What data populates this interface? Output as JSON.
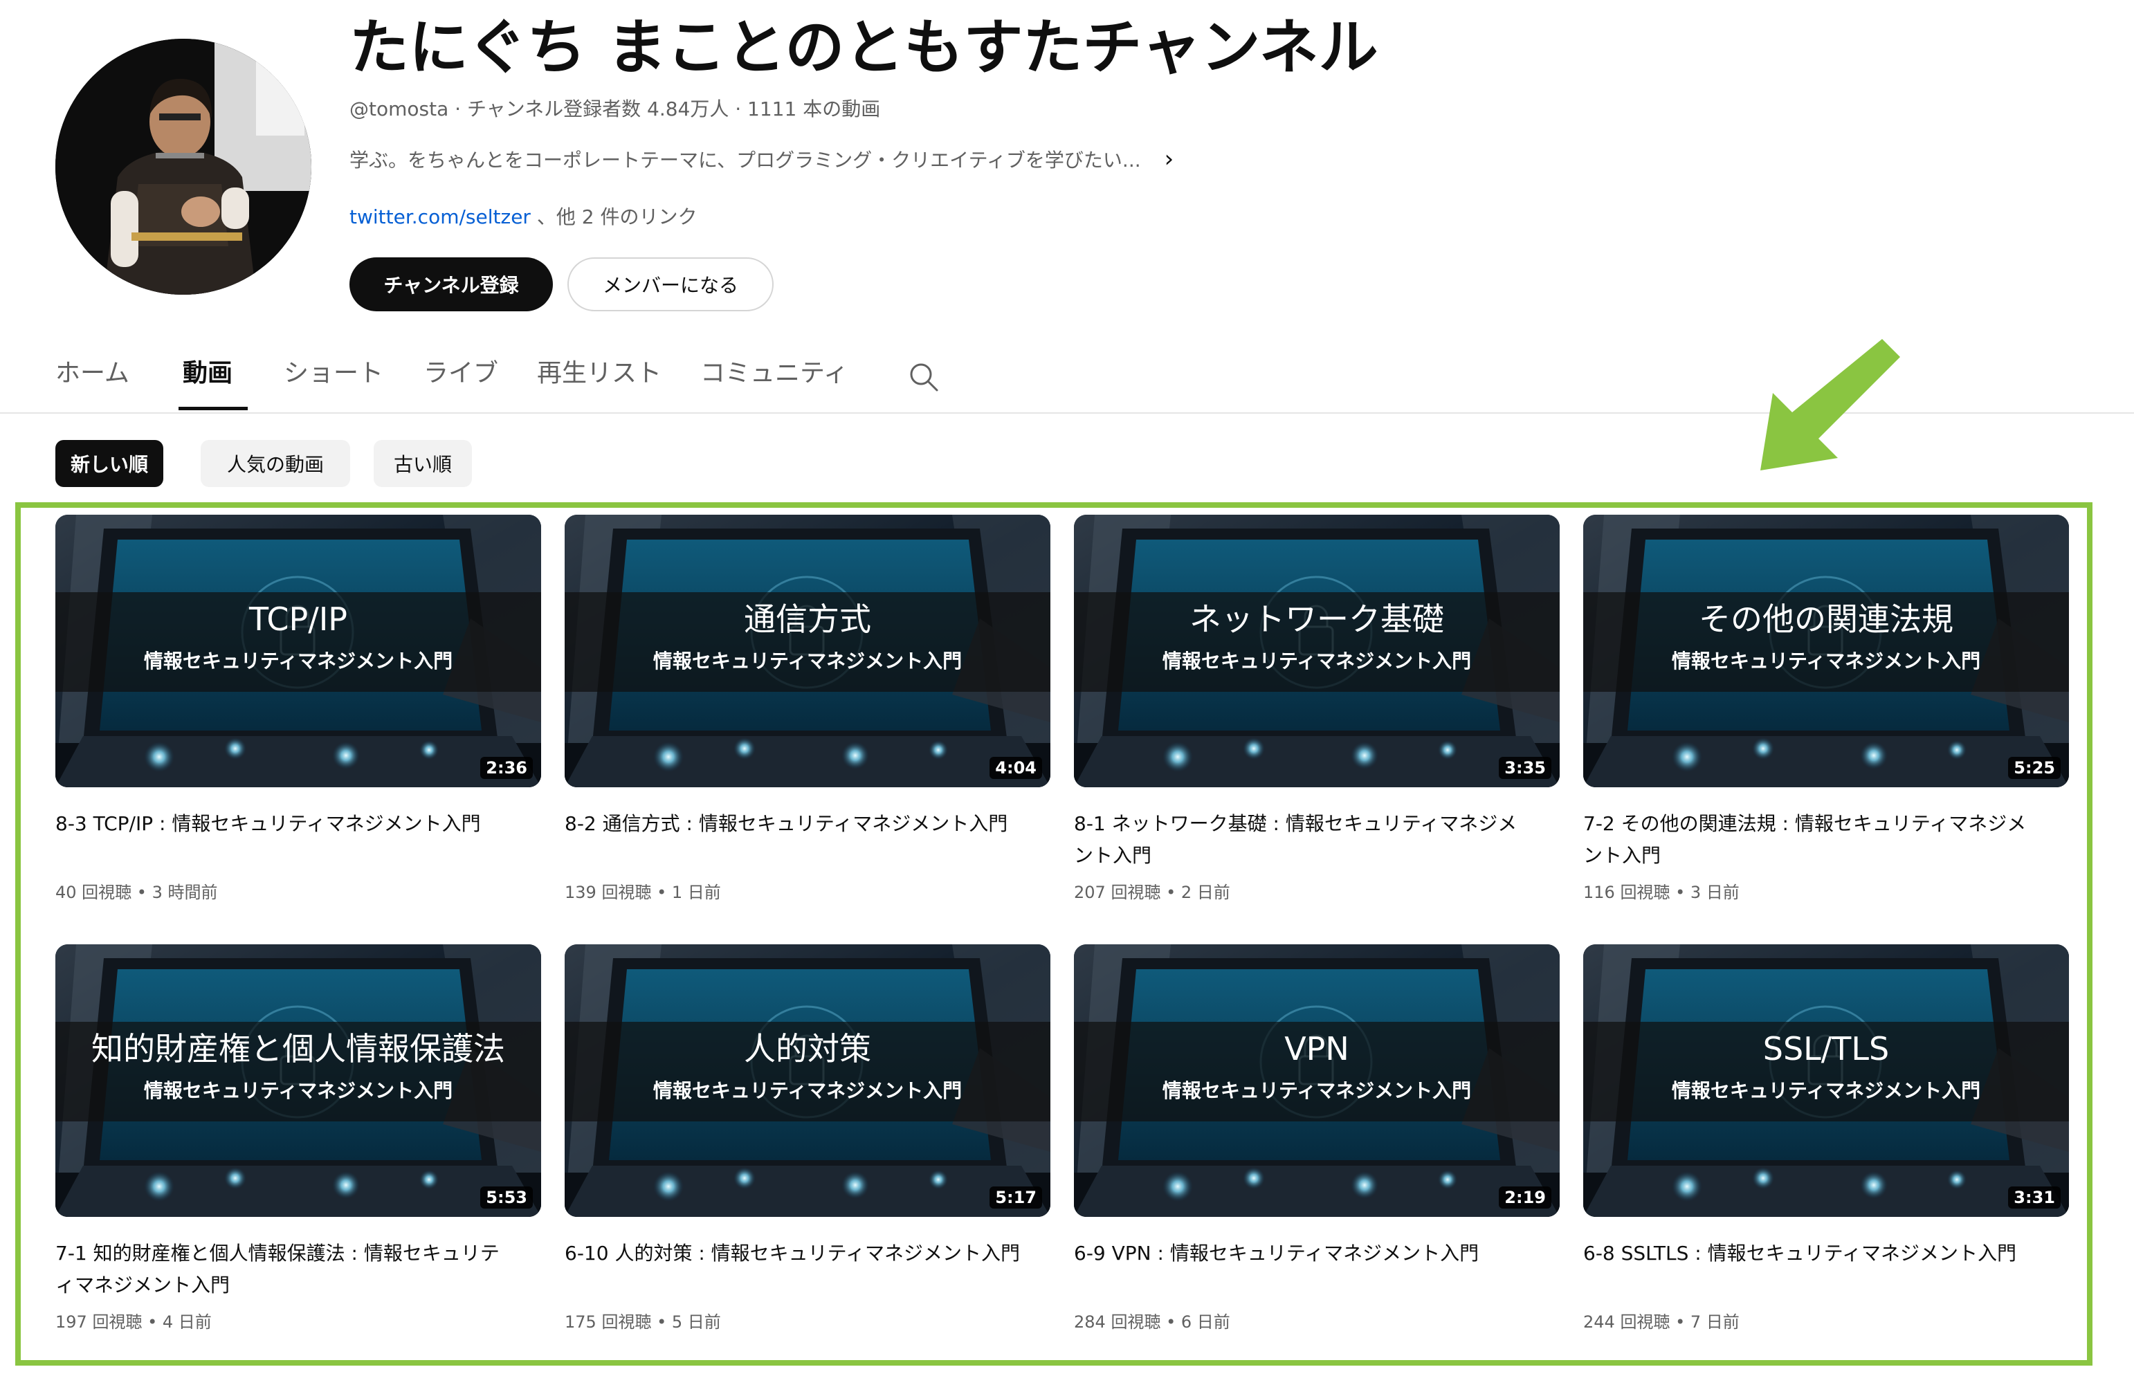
{
  "channel": {
    "title": "たにぐち まことのともすたチャンネル",
    "meta": "@tomosta · チャンネル登録者数 4.84万人 · 1111 本の動画",
    "description": "学ぶ。をちゃんとをコーポレートテーマに、プログラミング・クリエイティブを学びたい...",
    "link_primary": "twitter.com/seltzer",
    "link_suffix": " 、他 2 件のリンク",
    "subscribe_label": "チャンネル登録",
    "member_label": "メンバーになる"
  },
  "icons": {
    "description_chevron": "chevron-right-icon",
    "tab_search": "search-icon",
    "annotation": "arrow-down-left-icon"
  },
  "colors": {
    "accent_green": "#8ac541",
    "link_blue": "#065fd4",
    "text_primary": "#0f0f0f",
    "text_secondary": "#606060"
  },
  "tabs": [
    {
      "label": "ホーム",
      "active": false
    },
    {
      "label": "動画",
      "active": true
    },
    {
      "label": "ショート",
      "active": false
    },
    {
      "label": "ライブ",
      "active": false
    },
    {
      "label": "再生リスト",
      "active": false
    },
    {
      "label": "コミュニティ",
      "active": false
    }
  ],
  "chips": [
    {
      "label": "新しい順",
      "active": true
    },
    {
      "label": "人気の動画",
      "active": false
    },
    {
      "label": "古い順",
      "active": false
    }
  ],
  "videos": [
    {
      "thumb_title": "TCP/IP",
      "thumb_subtitle": "情報セキュリティマネジメント入門",
      "duration": "2:36",
      "title": "8-3 TCP/IP : 情報セキュリティマネジメント入門",
      "meta": "40 回視聴 • 3 時間前"
    },
    {
      "thumb_title": "通信方式",
      "thumb_subtitle": "情報セキュリティマネジメント入門",
      "duration": "4:04",
      "title": "8-2 通信方式 : 情報セキュリティマネジメント入門",
      "meta": "139 回視聴 • 1 日前"
    },
    {
      "thumb_title": "ネットワーク基礎",
      "thumb_subtitle": "情報セキュリティマネジメント入門",
      "duration": "3:35",
      "title": "8-1 ネットワーク基礎 : 情報セキュリティマネジメント入門",
      "meta": "207 回視聴 • 2 日前"
    },
    {
      "thumb_title": "その他の関連法規",
      "thumb_subtitle": "情報セキュリティマネジメント入門",
      "duration": "5:25",
      "title": "7-2 その他の関連法規 : 情報セキュリティマネジメント入門",
      "meta": "116 回視聴 • 3 日前"
    },
    {
      "thumb_title": "知的財産権と個人情報保護法",
      "thumb_subtitle": "情報セキュリティマネジメント入門",
      "duration": "5:53",
      "title": "7-1 知的財産権と個人情報保護法 : 情報セキュリティマネジメント入門",
      "meta": "197 回視聴 • 4 日前"
    },
    {
      "thumb_title": "人的対策",
      "thumb_subtitle": "情報セキュリティマネジメント入門",
      "duration": "5:17",
      "title": "6-10 人的対策 : 情報セキュリティマネジメント入門",
      "meta": "175 回視聴 • 5 日前"
    },
    {
      "thumb_title": "VPN",
      "thumb_subtitle": "情報セキュリティマネジメント入門",
      "duration": "2:19",
      "title": "6-9 VPN : 情報セキュリティマネジメント入門",
      "meta": "284 回視聴 • 6 日前"
    },
    {
      "thumb_title": "SSL/TLS",
      "thumb_subtitle": "情報セキュリティマネジメント入門",
      "duration": "3:31",
      "title": "6-8 SSLTLS : 情報セキュリティマネジメント入門",
      "meta": "244 回視聴 • 7 日前"
    }
  ]
}
